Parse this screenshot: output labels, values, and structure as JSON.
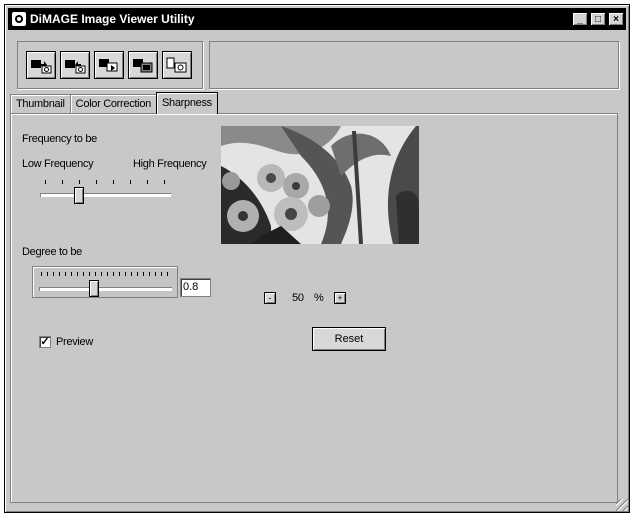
{
  "window": {
    "title": "DiMAGE Image Viewer Utility",
    "buttons": {
      "minimize": "_",
      "maximize": "□",
      "close": "×"
    }
  },
  "toolbar": {
    "buttons": [
      "open-camera-icon",
      "save-camera-icon",
      "transfer-icon",
      "exchange-icon",
      "camera-settings-icon"
    ]
  },
  "tabs": [
    {
      "label": "Thumbnail"
    },
    {
      "label": "Color Correction"
    },
    {
      "label": "Sharpness",
      "active": true
    }
  ],
  "sharpness": {
    "frequency_label": "Frequency to be",
    "low_label": "Low Frequency",
    "high_label": "High Frequency",
    "frequency_position": 0.3,
    "degree_label": "Degree to be",
    "degree_value": "0.8",
    "degree_position": 0.4,
    "zoom_minus": "-",
    "zoom_value": "50",
    "zoom_unit": "%",
    "zoom_plus": "+",
    "preview_label": "Preview",
    "preview_checked": true,
    "reset_label": "Reset"
  }
}
